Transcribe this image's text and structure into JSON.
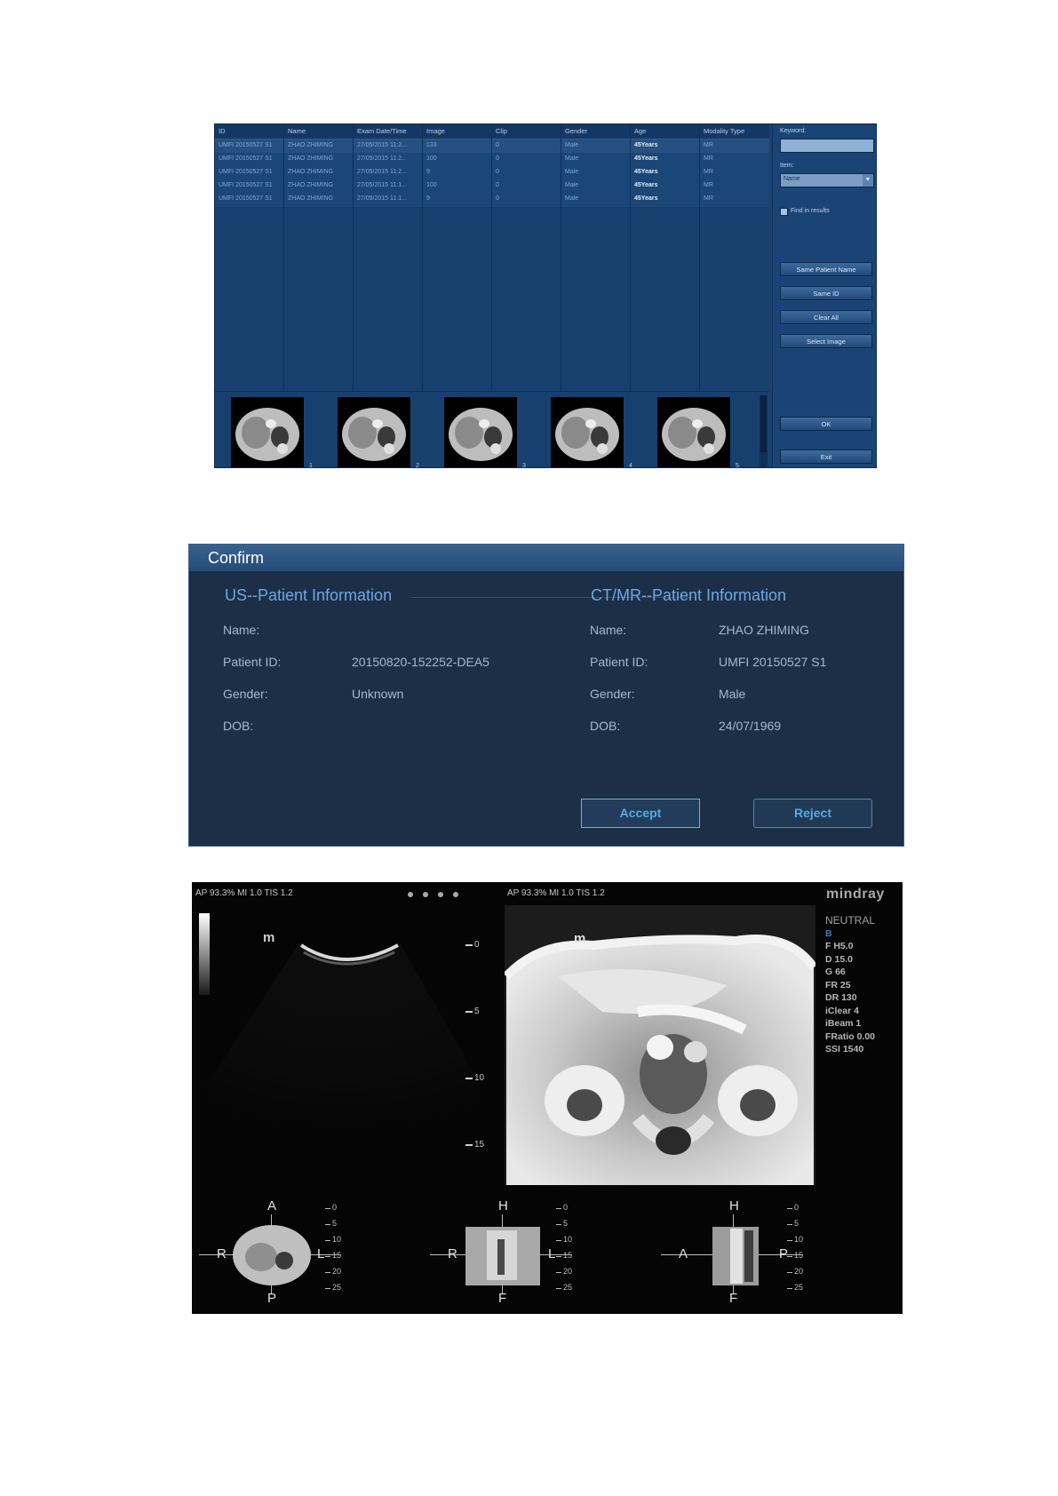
{
  "review_screen": {
    "columns": [
      "ID",
      "Name",
      "Exam Date/Time",
      "Image",
      "Clip",
      "Gender",
      "Age",
      "Modality Type"
    ],
    "rows": [
      [
        "UMFI 20150527 S1",
        "ZHAO ZHIMING",
        "27/05/2015 11:2...",
        "133",
        "0",
        "Male",
        "45Years",
        "MR"
      ],
      [
        "UMFI 20150527 S1",
        "ZHAO ZHIMING",
        "27/05/2015 11:2...",
        "100",
        "0",
        "Male",
        "45Years",
        "MR"
      ],
      [
        "UMFI 20150527 S1",
        "ZHAO ZHIMING",
        "27/05/2015 11:2...",
        "9",
        "0",
        "Male",
        "45Years",
        "MR"
      ],
      [
        "UMFI 20150527 S1",
        "ZHAO ZHIMING",
        "27/05/2015 11:1...",
        "100",
        "0",
        "Male",
        "45Years",
        "MR"
      ],
      [
        "UMFI 20150527 S1",
        "ZHAO ZHIMING",
        "27/05/2015 11:1...",
        "9",
        "0",
        "Male",
        "45Years",
        "MR"
      ]
    ],
    "keyword_label": "Keyword:",
    "keyword_value": "",
    "item_label": "Item:",
    "item_value": "Name",
    "find_in_results_label": "Find in results",
    "buttons": [
      "Same Patient Name",
      "Same ID",
      "Clear All",
      "Select Image"
    ],
    "ok_label": "OK",
    "exit_label": "Exit",
    "thumbnail_numbers": [
      "1",
      "2",
      "3",
      "4",
      "5"
    ]
  },
  "confirm_dialog": {
    "title": "Confirm",
    "us": {
      "heading": "US--Patient Information",
      "name_label": "Name:",
      "name_value": "",
      "id_label": "Patient ID:",
      "id_value": "20150820-152252-DEA5",
      "gender_label": "Gender:",
      "gender_value": "Unknown",
      "dob_label": "DOB:",
      "dob_value": ""
    },
    "ctmr": {
      "heading": "CT/MR--Patient Information",
      "name_label": "Name:",
      "name_value": "ZHAO ZHIMING",
      "id_label": "Patient ID:",
      "id_value": "UMFI 20150527 S1",
      "gender_label": "Gender:",
      "gender_value": "Male",
      "dob_label": "DOB:",
      "dob_value": "24/07/1969"
    },
    "accept_label": "Accept",
    "reject_label": "Reject"
  },
  "fusion_screen": {
    "left_header": "AP 93.3%  MI 1.0 TIS 1.2",
    "right_header": "AP 93.3%  MI 1.0 TIS 1.2",
    "logo": "mindray",
    "probe_marker": "m",
    "depth_ticks": [
      "0",
      "5",
      "10",
      "15"
    ],
    "params": [
      "NEUTRAL",
      "B",
      "F H5.0",
      "D 15.0",
      "G 66",
      "FR 25",
      "DR 130",
      "iClear 4",
      "iBeam 1",
      "FRatio 0.00",
      "SSI 1540"
    ],
    "views": [
      {
        "top": "A",
        "bottom": "P",
        "left": "R",
        "right": "L"
      },
      {
        "top": "H",
        "bottom": "F",
        "left": "R",
        "right": "L"
      },
      {
        "top": "H",
        "bottom": "F",
        "left": "A",
        "right": "P"
      }
    ],
    "mini_scale": [
      "0",
      "5",
      "10",
      "15",
      "20",
      "25"
    ]
  }
}
